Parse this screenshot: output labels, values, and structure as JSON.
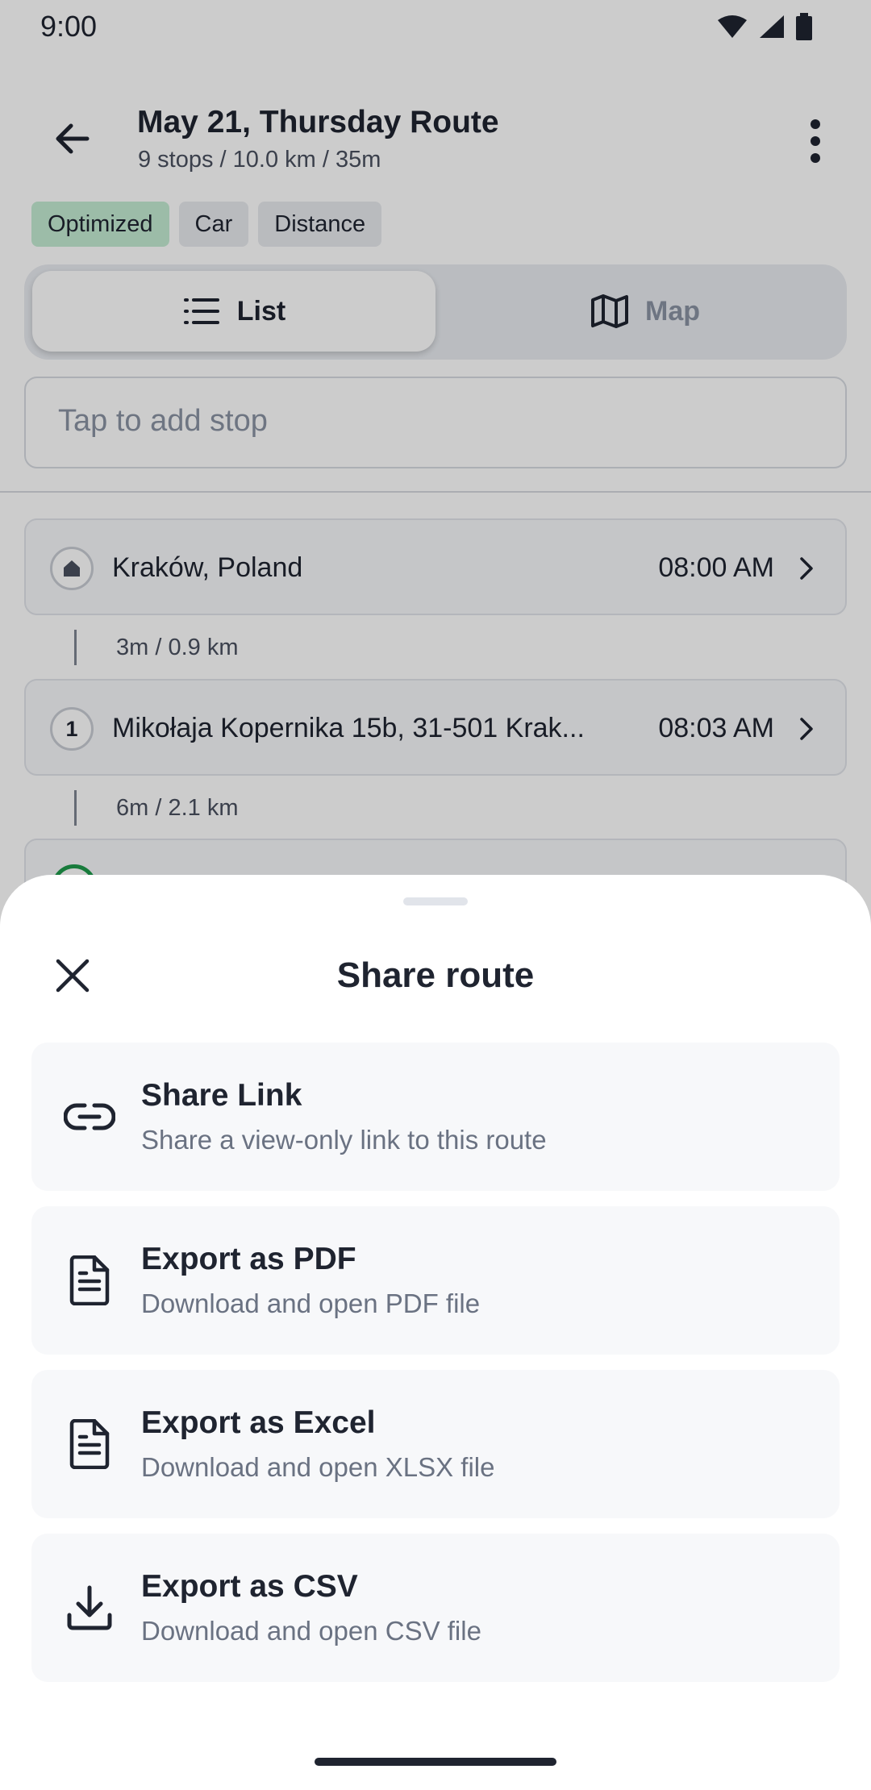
{
  "status_bar": {
    "time": "9:00"
  },
  "header": {
    "title": "May 21, Thursday Route",
    "subtitle": "9 stops / 10.0 km / 35m"
  },
  "chips": [
    "Optimized",
    "Car",
    "Distance"
  ],
  "view_toggle": {
    "list_label": "List",
    "map_label": "Map",
    "selected": "List"
  },
  "add_stop": {
    "placeholder": "Tap to add stop"
  },
  "stops": [
    {
      "badge": "",
      "name": "Kraków, Poland",
      "time": "08:00 AM"
    },
    {
      "badge": "1",
      "name": "Mikołaja Kopernika 15b, 31-501 Krak...",
      "time": "08:03 AM"
    }
  ],
  "legs": [
    "3m / 0.9 km",
    "6m / 2.1 km"
  ],
  "share_sheet": {
    "title": "Share route",
    "options": [
      {
        "icon": "link-icon",
        "title": "Share Link",
        "description": "Share a view-only link to this route"
      },
      {
        "icon": "document-icon",
        "title": "Export as PDF",
        "description": "Download and open PDF file"
      },
      {
        "icon": "document-icon",
        "title": "Export as Excel",
        "description": "Download and open XLSX file"
      },
      {
        "icon": "download-icon",
        "title": "Export as CSV",
        "description": "Download and open CSV file"
      }
    ]
  },
  "colors": {
    "accent_green": "#1f9a4c",
    "optimized_chip": "#c4ecd3",
    "text_primary": "#1f2430",
    "text_secondary": "#6a7282"
  }
}
